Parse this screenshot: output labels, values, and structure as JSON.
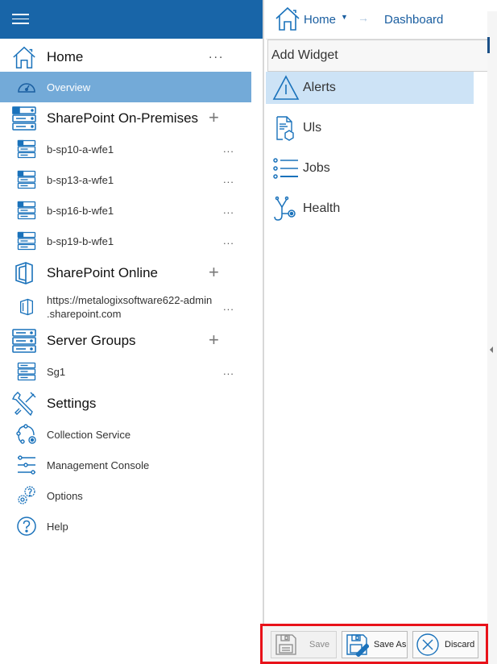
{
  "sidebar": {
    "menu_icon": "hamburger-icon",
    "items": [
      {
        "label": "Home",
        "icon": "home-icon",
        "level": "top",
        "action": "more",
        "more": "..."
      },
      {
        "label": "Overview",
        "icon": "dashboard-gauge-icon",
        "level": "sub",
        "selected": true
      },
      {
        "label": "SharePoint On-Premises",
        "icon": "sharepoint-server-icon",
        "level": "top",
        "action": "add",
        "add": "+"
      },
      {
        "label": "b-sp10-a-wfe1",
        "icon": "sharepoint-server-icon",
        "level": "sub",
        "more": "..."
      },
      {
        "label": "b-sp13-a-wfe1",
        "icon": "sharepoint-server-icon",
        "level": "sub",
        "more": "..."
      },
      {
        "label": "b-sp16-b-wfe1",
        "icon": "sharepoint-server-icon",
        "level": "sub",
        "more": "..."
      },
      {
        "label": "b-sp19-b-wfe1",
        "icon": "sharepoint-server-icon",
        "level": "sub",
        "more": "..."
      },
      {
        "label": "SharePoint Online",
        "icon": "office-door-icon",
        "level": "top",
        "action": "add",
        "add": "+"
      },
      {
        "label": "https://metalogixsoftware622-admin",
        "label2": ".sharepoint.com",
        "icon": "office-door-icon",
        "level": "sub",
        "more": "..."
      },
      {
        "label": "Server Groups",
        "icon": "server-stack-icon",
        "level": "top",
        "action": "add",
        "add": "+"
      },
      {
        "label": "Sg1",
        "icon": "server-stack-icon",
        "level": "sub",
        "more": "..."
      },
      {
        "label": "Settings",
        "icon": "tools-icon",
        "level": "top"
      },
      {
        "label": "Collection Service",
        "icon": "collection-service-icon",
        "level": "sub"
      },
      {
        "label": "Management Console",
        "icon": "sliders-icon",
        "level": "sub"
      },
      {
        "label": "Options",
        "icon": "gears-icon",
        "level": "sub"
      },
      {
        "label": "Help",
        "icon": "help-icon",
        "level": "sub"
      }
    ]
  },
  "breadcrumb": {
    "home": "Home",
    "caret": "▼",
    "separator": "→",
    "current": "Dashboard"
  },
  "widgets": {
    "header": "Add Widget",
    "items": [
      {
        "label": "Alerts",
        "icon": "warning-icon",
        "selected": true
      },
      {
        "label": "Uls",
        "icon": "uls-log-icon"
      },
      {
        "label": "Jobs",
        "icon": "list-icon"
      },
      {
        "label": "Health",
        "icon": "stethoscope-icon"
      }
    ]
  },
  "footer": {
    "save": "Save",
    "save_as": "Save As",
    "discard": "Discard"
  },
  "colors": {
    "header_blue": "#1865a8",
    "selected_nav": "#73aad8",
    "selected_widget": "#cde3f6",
    "icon_blue": "#1a72bb",
    "highlight_frame": "#e8121a"
  }
}
